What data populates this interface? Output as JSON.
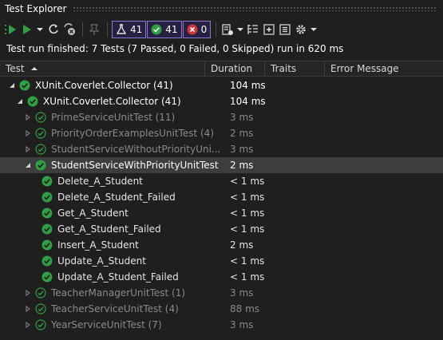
{
  "window": {
    "title": "Test Explorer"
  },
  "toolbar": {
    "total_count": "41",
    "passed_count": "41",
    "failed_count": "0"
  },
  "status": "Test run finished: 7 Tests (7 Passed, 0 Failed, 0 Skipped) run in 620 ms",
  "columns": {
    "test": "Test",
    "duration": "Duration",
    "traits": "Traits",
    "error": "Error Message"
  },
  "rows": [
    {
      "label": "XUnit.Coverlet.Collector (41)",
      "duration": "104 ms"
    },
    {
      "label": "XUnit.Coverlet.Collector (41)",
      "duration": "104 ms"
    },
    {
      "label": "PrimeServiceUnitTest (11)",
      "duration": "3 ms"
    },
    {
      "label": "PriorityOrderExamplesUnitTest (4)",
      "duration": "2 ms"
    },
    {
      "label": "StudentServiceWithoutPriorityUni...",
      "duration": "3 ms"
    },
    {
      "label": "StudentServiceWithPriorityUnitTest",
      "duration": "2 ms"
    },
    {
      "label": "Delete_A_Student",
      "duration": "< 1 ms"
    },
    {
      "label": "Delete_A_Student_Failed",
      "duration": "< 1 ms"
    },
    {
      "label": "Get_A_Student",
      "duration": "< 1 ms"
    },
    {
      "label": "Get_A_Student_Failed",
      "duration": "< 1 ms"
    },
    {
      "label": "Insert_A_Student",
      "duration": "2 ms"
    },
    {
      "label": "Update_A_Student",
      "duration": "< 1 ms"
    },
    {
      "label": "Update_A_Student_Failed",
      "duration": "< 1 ms"
    },
    {
      "label": "TeacherManagerUnitTest (1)",
      "duration": "3 ms"
    },
    {
      "label": "TeacherServiceUnitTest (4)",
      "duration": "88 ms"
    },
    {
      "label": "YearServiceUnitTest (7)",
      "duration": "3 ms"
    }
  ],
  "colors": {
    "passed": "#2ea043",
    "failed": "#d13438",
    "accent": "#8a7ad6",
    "background": "#1f1f1f"
  }
}
